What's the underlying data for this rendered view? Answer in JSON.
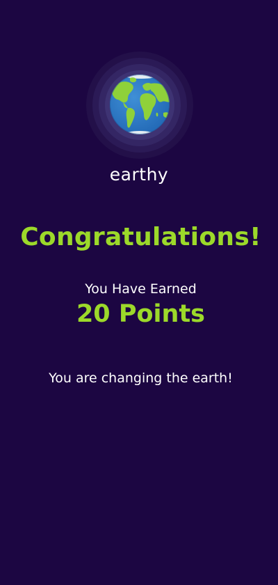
{
  "app": {
    "brand_name": "earthy",
    "logo_icon": "earth-globe-icon"
  },
  "congrats": {
    "headline": "Congratulations!",
    "earned_label": "You Have Earned",
    "points_text": "20 Points",
    "message": "You are changing the earth!"
  },
  "colors": {
    "background": "#1c0642",
    "accent": "#9cd92a",
    "text": "#ffffff"
  }
}
